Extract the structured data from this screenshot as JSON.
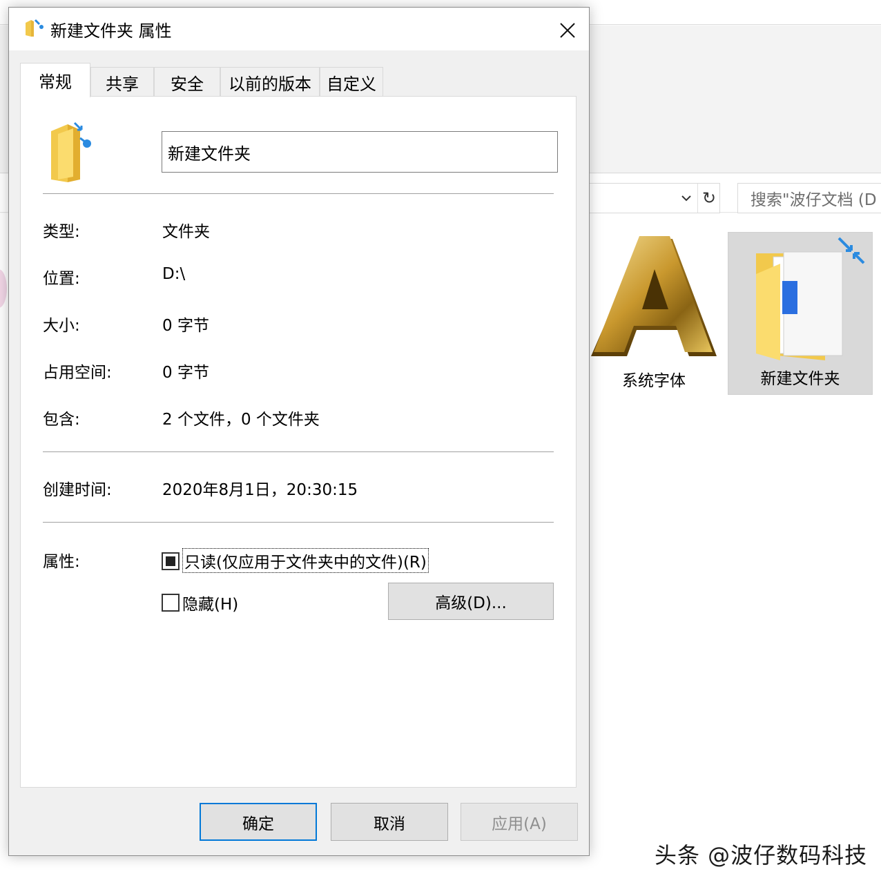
{
  "explorer": {
    "search_placeholder": "搜索\"波仔文档 (D",
    "files": [
      {
        "name": "系统字体",
        "icon": "font-file-icon"
      },
      {
        "name": "新建文件夹",
        "icon": "shared-folder-icon",
        "selected": true
      }
    ]
  },
  "dialog": {
    "title": "新建文件夹 属性",
    "tabs": [
      {
        "label": "常规",
        "active": true
      },
      {
        "label": "共享"
      },
      {
        "label": "安全"
      },
      {
        "label": "以前的版本"
      },
      {
        "label": "自定义"
      }
    ],
    "folder_name": "新建文件夹",
    "properties": {
      "type_label": "类型:",
      "type_value": "文件夹",
      "location_label": "位置:",
      "location_value": "D:\\",
      "size_label": "大小:",
      "size_value": "0 字节",
      "disk_size_label": "占用空间:",
      "disk_size_value": "0 字节",
      "contains_label": "包含:",
      "contains_value": "2 个文件，0 个文件夹",
      "created_label": "创建时间:",
      "created_value": "2020年8月1日，20:30:15",
      "attributes_label": "属性:"
    },
    "attributes": {
      "readonly_label": "只读(仅应用于文件夹中的文件)(R)",
      "readonly_state": "indeterminate",
      "hidden_label": "隐藏(H)",
      "hidden_checked": false,
      "advanced_button": "高级(D)..."
    },
    "buttons": {
      "ok": "确定",
      "cancel": "取消",
      "apply": "应用(A)"
    }
  },
  "watermark": "头条 @波仔数码科技",
  "colors": {
    "focus_blue": "#0078d7",
    "dialog_bg": "#f0f0f0",
    "selection_gray": "#d9d9d9"
  }
}
